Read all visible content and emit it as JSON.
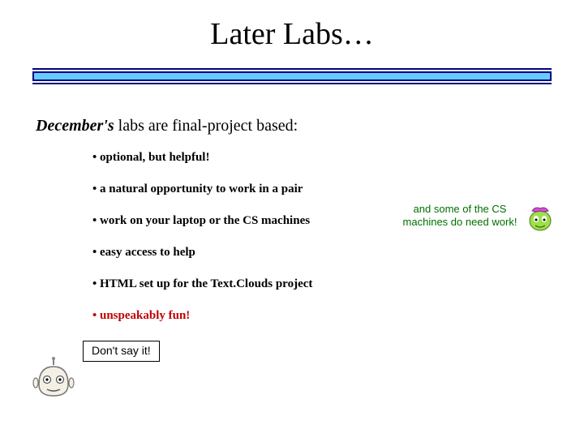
{
  "title": "Later Labs…",
  "intro": {
    "emph": "December's",
    "rest": " labs are final-project based:"
  },
  "bullets": {
    "b0": "• optional, but helpful!",
    "b1": "• a natural opportunity to work in a pair",
    "b2": "• work on your laptop or the CS machines",
    "b3": "• easy access to help",
    "b4": "• HTML set up for the Text.Clouds project",
    "b5": "• unspeakably fun!"
  },
  "side_note": "and some of the CS machines do need work!",
  "callout": "Don't say it!",
  "colors": {
    "rule_border": "#000080",
    "rule_fill": "#66ccff",
    "accent_red": "#c00000",
    "note_green": "#007000"
  }
}
